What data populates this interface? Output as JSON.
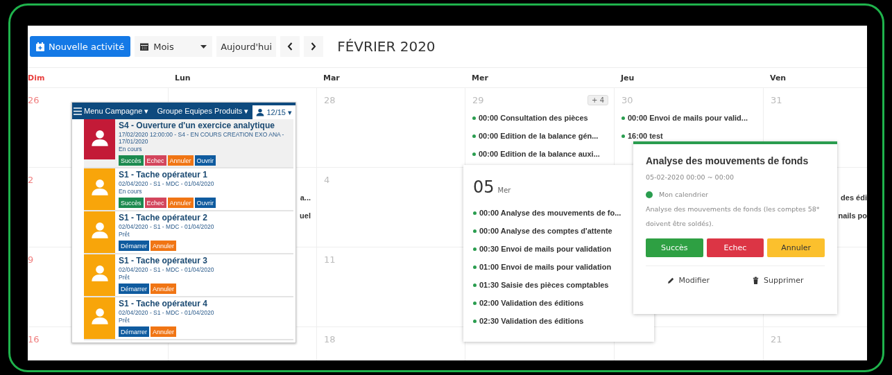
{
  "toolbar": {
    "new_button": "Nouvelle activité",
    "view_select": "Mois",
    "today_button": "Aujourd'hui",
    "title": "FÉVRIER 2020"
  },
  "calendar": {
    "weekdays": [
      {
        "label": "Dim",
        "weekend": true
      },
      {
        "label": "Lun",
        "weekend": false
      },
      {
        "label": "Mar",
        "weekend": false
      },
      {
        "label": "Mer",
        "weekend": false
      },
      {
        "label": "Jeu",
        "weekend": false
      },
      {
        "label": "Ven",
        "weekend": false
      }
    ],
    "weeks": [
      {
        "dim": {
          "number": "26"
        },
        "mar": {
          "number": "28"
        },
        "mer": {
          "number": "29",
          "more": "+ 4",
          "events": [
            {
              "text": "00:00 Consultation des pièces",
              "cut": false
            },
            {
              "text": "00:00 Edition de la balance gén...",
              "cut": false
            },
            {
              "text": "00:00 Edition de la balance auxi...",
              "cut": false
            }
          ]
        },
        "jeu": {
          "number": "30",
          "events": [
            {
              "text": "00:00 Envoi de mails pour valid...",
              "cut": false
            },
            {
              "text": "16:00 test",
              "cut": false
            }
          ]
        },
        "ven": {
          "number": "31"
        }
      },
      {
        "dim": {
          "number": "2"
        },
        "lun": {
          "events": [
            {
              "text": "a...",
              "cut": true
            },
            {
              "text": "uel",
              "cut": true
            }
          ]
        },
        "mar": {
          "number": "4"
        },
        "ven": {
          "events": [
            {
              "text": "des édi",
              "cut": true
            },
            {
              "text": "nails po",
              "cut": true
            }
          ]
        }
      },
      {
        "dim": {
          "number": "9"
        },
        "mar": {
          "number": "11"
        }
      },
      {
        "dim": {
          "number": "16"
        },
        "mar": {
          "number": "18"
        },
        "ven": {
          "number": "21"
        }
      }
    ]
  },
  "campaign_panel": {
    "menu": "Menu Campagne ▾",
    "group": "Groupe Equipes Produits ▾",
    "counter": "12/15 ▾",
    "items": [
      {
        "title": "S4 - Ouverture d'un exercice analytique",
        "meta": "17/02/2020 12:00:00 - S4 - EN COURS CREATION EXO ANA - 17/01/2020",
        "status": "En cours",
        "color": "#c31a37",
        "highlighted": true,
        "actions": [
          {
            "label": "Succès",
            "kind": "success"
          },
          {
            "label": "Echec",
            "kind": "danger"
          },
          {
            "label": "Annuler",
            "kind": "warning"
          },
          {
            "label": "Ouvrir",
            "kind": "primary"
          }
        ]
      },
      {
        "title": "S1 - Tache opérateur 1",
        "meta": "02/04/2020 - S1 - MDC - 01/04/2020",
        "status": "En cours",
        "color": "#f8a50a",
        "highlighted": false,
        "actions": [
          {
            "label": "Succès",
            "kind": "success"
          },
          {
            "label": "Echec",
            "kind": "danger"
          },
          {
            "label": "Annuler",
            "kind": "warning"
          },
          {
            "label": "Ouvrir",
            "kind": "primary"
          }
        ]
      },
      {
        "title": "S1 - Tache opérateur 2",
        "meta": "02/04/2020 - S1 - MDC - 01/04/2020",
        "status": "Prêt",
        "color": "#f8a50a",
        "highlighted": false,
        "actions": [
          {
            "label": "Démarrer",
            "kind": "primary"
          },
          {
            "label": "Annuler",
            "kind": "warning"
          }
        ]
      },
      {
        "title": "S1 - Tache opérateur 3",
        "meta": "02/04/2020 - S1 - MDC - 01/04/2020",
        "status": "Prêt",
        "color": "#f8a50a",
        "highlighted": false,
        "actions": [
          {
            "label": "Démarrer",
            "kind": "primary"
          },
          {
            "label": "Annuler",
            "kind": "warning"
          }
        ]
      },
      {
        "title": "S1 - Tache opérateur 4",
        "meta": "02/04/2020 - S1 - MDC - 01/04/2020",
        "status": "Prêt",
        "color": "#f8a50a",
        "highlighted": false,
        "actions": [
          {
            "label": "Démarrer",
            "kind": "primary"
          },
          {
            "label": "Annuler",
            "kind": "warning"
          }
        ]
      }
    ]
  },
  "day_popup": {
    "day": "05",
    "weekday": "Mer",
    "events": [
      "00:00 Analyse des mouvements de fo...",
      "00:00 Analyse des comptes d'attente",
      "00:30 Envoi de mails pour validation",
      "01:00 Envoi de mails pour validation",
      "01:30 Saisie des pièces comptables",
      "02:00 Validation des éditions",
      "02:30 Validation des éditions"
    ]
  },
  "event_popup": {
    "title": "Analyse des mouvements de fonds",
    "time": "05-02-2020 00:00 ~ 00:00",
    "calendar": "Mon calendrier",
    "description": "Analyse des mouvements de fonds (les comptes 58* doivent être soldés).",
    "actions": [
      {
        "label": "Succès",
        "kind": "success"
      },
      {
        "label": "Echec",
        "kind": "danger"
      },
      {
        "label": "Annuler",
        "kind": "warning"
      }
    ],
    "edit": "Modifier",
    "delete": "Supprimer"
  }
}
